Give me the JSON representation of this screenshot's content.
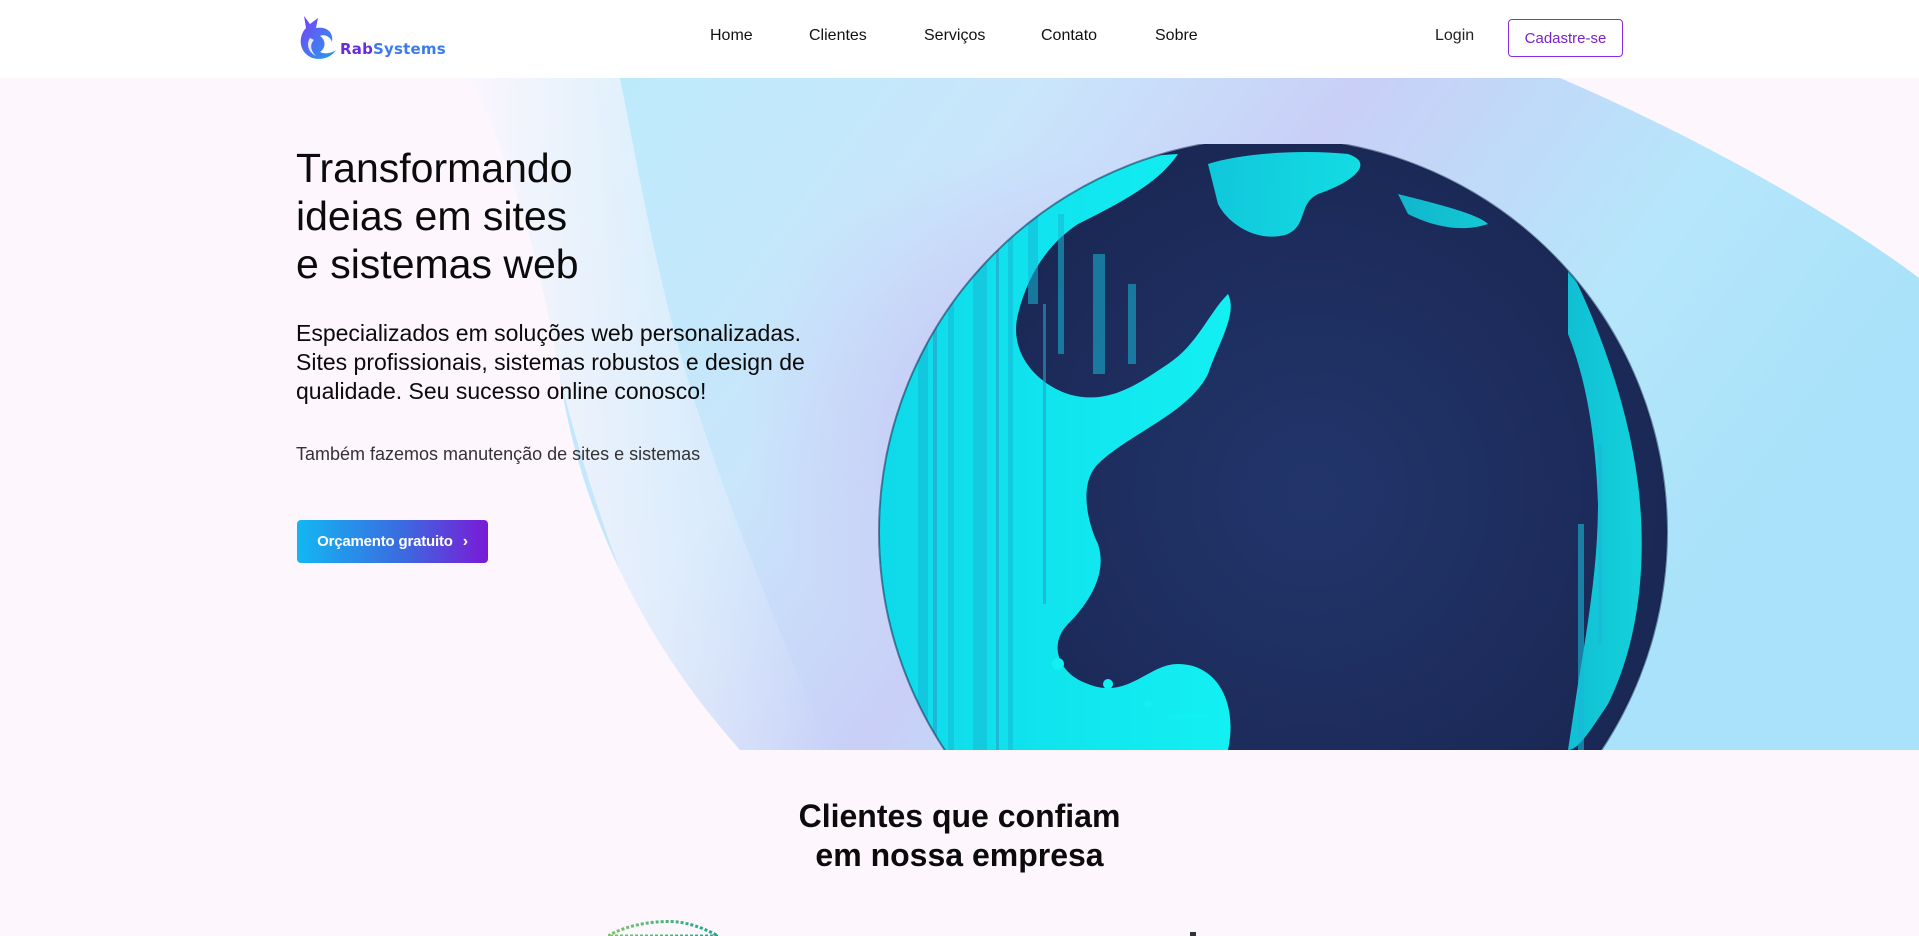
{
  "brand": {
    "name_part1": "Rab",
    "name_part2": "Systems",
    "accent": "#8a2be2",
    "secondary": "#3a7bf0"
  },
  "nav": {
    "items": [
      "Home",
      "Clientes",
      "Serviços",
      "Contato",
      "Sobre"
    ]
  },
  "auth": {
    "login_label": "Login",
    "signup_label": "Cadastre-se"
  },
  "hero": {
    "title": "Transformando\nideias em sites\ne sistemas web",
    "subtitle": "Especializados em soluções web personalizadas. Sites profissionais, sistemas robustos e design de qualidade. Seu sucesso online conosco!",
    "note": "Também fazemos manutenção de sites e sistemas",
    "cta_label": "Orçamento gratuito",
    "cta_icon": "chevron-right-icon",
    "globe_colors": {
      "land": "#10e6f0",
      "ocean": "#1c2b5e"
    }
  },
  "clients": {
    "title": "Clientes que confiam\nem nossa empresa"
  }
}
